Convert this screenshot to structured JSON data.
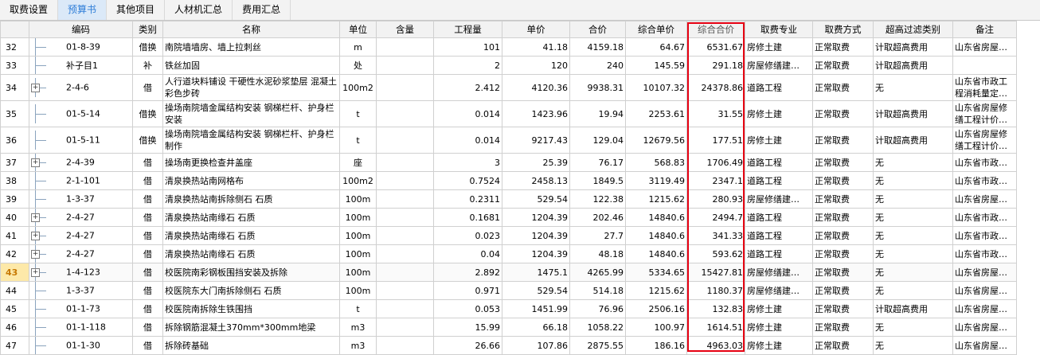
{
  "tabs": [
    "取费设置",
    "预算书",
    "其他项目",
    "人材机汇总",
    "费用汇总"
  ],
  "active_tab": 1,
  "columns": [
    "编码",
    "类别",
    "名称",
    "单位",
    "含量",
    "工程量",
    "单价",
    "合价",
    "综合单价",
    "综合合价",
    "取费专业",
    "取费方式",
    "超高过滤类别",
    "备注"
  ],
  "rows": [
    {
      "no": "32",
      "code": "01-8-39",
      "expand": false,
      "type": "借换",
      "name": "南院墙墙房、墙上拉刺丝",
      "unit": "m",
      "content": "",
      "qty": "101",
      "price": "41.18",
      "amount": "4159.18",
      "unit_total": "64.67",
      "total": "6531.67",
      "spec": "房修土建",
      "method": "正常取费",
      "filter": "计取超高费用",
      "note": "山东省房屋…"
    },
    {
      "no": "33",
      "code": "补子目1",
      "expand": false,
      "type": "补",
      "name": "铁丝加固",
      "unit": "处",
      "content": "",
      "qty": "2",
      "price": "120",
      "amount": "240",
      "unit_total": "145.59",
      "total": "291.18",
      "spec": "房屋修缮建…",
      "method": "正常取费",
      "filter": "计取超高费用",
      "note": ""
    },
    {
      "no": "34",
      "code": "2-4-6",
      "expand": true,
      "type": "借",
      "name": "人行道块料铺设 干硬性水泥砂浆垫层 混凝土彩色步砖",
      "unit": "100m2",
      "content": "",
      "qty": "2.412",
      "price": "4120.36",
      "amount": "9938.31",
      "unit_total": "10107.32",
      "total": "24378.86",
      "spec": "道路工程",
      "method": "正常取费",
      "filter": "无",
      "note": "山东省市政工程消耗量定…"
    },
    {
      "no": "35",
      "code": "01-5-14",
      "expand": false,
      "type": "借换",
      "name": "操场南院墙金属结构安装 钢梯栏杆、护身栏安装",
      "unit": "t",
      "content": "",
      "qty": "0.014",
      "price": "1423.96",
      "amount": "19.94",
      "unit_total": "2253.61",
      "total": "31.55",
      "spec": "房修土建",
      "method": "正常取费",
      "filter": "计取超高费用",
      "note": "山东省房屋修缮工程计价…"
    },
    {
      "no": "36",
      "code": "01-5-11",
      "expand": false,
      "type": "借换",
      "name": "操场南院墙金属结构安装 钢梯栏杆、护身栏制作",
      "unit": "t",
      "content": "",
      "qty": "0.014",
      "price": "9217.43",
      "amount": "129.04",
      "unit_total": "12679.56",
      "total": "177.51",
      "spec": "房修土建",
      "method": "正常取费",
      "filter": "计取超高费用",
      "note": "山东省房屋修缮工程计价…"
    },
    {
      "no": "37",
      "code": "2-4-39",
      "expand": true,
      "type": "借",
      "name": "操场南更换检查井盖座",
      "unit": "座",
      "content": "",
      "qty": "3",
      "price": "25.39",
      "amount": "76.17",
      "unit_total": "568.83",
      "total": "1706.49",
      "spec": "道路工程",
      "method": "正常取费",
      "filter": "无",
      "note": "山东省市政…"
    },
    {
      "no": "38",
      "code": "2-1-101",
      "expand": false,
      "type": "借",
      "name": "清泉换热站南网格布",
      "unit": "100m2",
      "content": "",
      "qty": "0.7524",
      "price": "2458.13",
      "amount": "1849.5",
      "unit_total": "3119.49",
      "total": "2347.1",
      "spec": "道路工程",
      "method": "正常取费",
      "filter": "无",
      "note": "山东省市政…"
    },
    {
      "no": "39",
      "code": "1-3-37",
      "expand": false,
      "type": "借",
      "name": "清泉换热站南拆除侧石 石质",
      "unit": "100m",
      "content": "",
      "qty": "0.2311",
      "price": "529.54",
      "amount": "122.38",
      "unit_total": "1215.62",
      "total": "280.93",
      "spec": "房屋修缮建…",
      "method": "正常取费",
      "filter": "无",
      "note": "山东省房屋…"
    },
    {
      "no": "40",
      "code": "2-4-27",
      "expand": true,
      "type": "借",
      "name": "清泉换热站南缘石 石质",
      "unit": "100m",
      "content": "",
      "qty": "0.1681",
      "price": "1204.39",
      "amount": "202.46",
      "unit_total": "14840.6",
      "total": "2494.7",
      "spec": "道路工程",
      "method": "正常取费",
      "filter": "无",
      "note": "山东省市政…"
    },
    {
      "no": "41",
      "code": "2-4-27",
      "expand": true,
      "type": "借",
      "name": "清泉换热站南缘石 石质",
      "unit": "100m",
      "content": "",
      "qty": "0.023",
      "price": "1204.39",
      "amount": "27.7",
      "unit_total": "14840.6",
      "total": "341.33",
      "spec": "道路工程",
      "method": "正常取费",
      "filter": "无",
      "note": "山东省市政…"
    },
    {
      "no": "42",
      "code": "2-4-27",
      "expand": true,
      "type": "借",
      "name": "清泉换热站南缘石 石质",
      "unit": "100m",
      "content": "",
      "qty": "0.04",
      "price": "1204.39",
      "amount": "48.18",
      "unit_total": "14840.6",
      "total": "593.62",
      "spec": "道路工程",
      "method": "正常取费",
      "filter": "无",
      "note": "山东省市政…"
    },
    {
      "no": "43",
      "code": "1-4-123",
      "expand": true,
      "type": "借",
      "name": "校医院南彩钢板围挡安装及拆除",
      "unit": "100m",
      "content": "",
      "qty": "2.892",
      "price": "1475.1",
      "amount": "4265.99",
      "unit_total": "5334.65",
      "total": "15427.81",
      "spec": "房屋修缮建…",
      "method": "正常取费",
      "filter": "无",
      "note": "山东省房屋…"
    },
    {
      "no": "44",
      "code": "1-3-37",
      "expand": false,
      "type": "借",
      "name": "校医院东大门南拆除侧石 石质",
      "unit": "100m",
      "content": "",
      "qty": "0.971",
      "price": "529.54",
      "amount": "514.18",
      "unit_total": "1215.62",
      "total": "1180.37",
      "spec": "房屋修缮建…",
      "method": "正常取费",
      "filter": "无",
      "note": "山东省房屋…"
    },
    {
      "no": "45",
      "code": "01-1-73",
      "expand": false,
      "type": "借",
      "name": "校医院南拆除生铁围挡",
      "unit": "t",
      "content": "",
      "qty": "0.053",
      "price": "1451.99",
      "amount": "76.96",
      "unit_total": "2506.16",
      "total": "132.83",
      "spec": "房修土建",
      "method": "正常取费",
      "filter": "计取超高费用",
      "note": "山东省房屋…"
    },
    {
      "no": "46",
      "code": "01-1-118",
      "expand": false,
      "type": "借",
      "name": "拆除钢筋混凝土370mm*300mm地梁",
      "unit": "m3",
      "content": "",
      "qty": "15.99",
      "price": "66.18",
      "amount": "1058.22",
      "unit_total": "100.97",
      "total": "1614.51",
      "spec": "房修土建",
      "method": "正常取费",
      "filter": "无",
      "note": "山东省房屋…"
    },
    {
      "no": "47",
      "code": "01-1-30",
      "expand": false,
      "type": "借",
      "name": "拆除砖基础",
      "unit": "m3",
      "content": "",
      "qty": "26.66",
      "price": "107.86",
      "amount": "2875.55",
      "unit_total": "186.16",
      "total": "4963.03",
      "spec": "房修土建",
      "method": "正常取费",
      "filter": "无",
      "note": "山东省房屋…"
    }
  ],
  "selected_row": "43",
  "colors": {
    "accent": "#2f7ed8",
    "highlight_border": "#e60012",
    "selected_rownum_bg": "#fde9a9"
  }
}
